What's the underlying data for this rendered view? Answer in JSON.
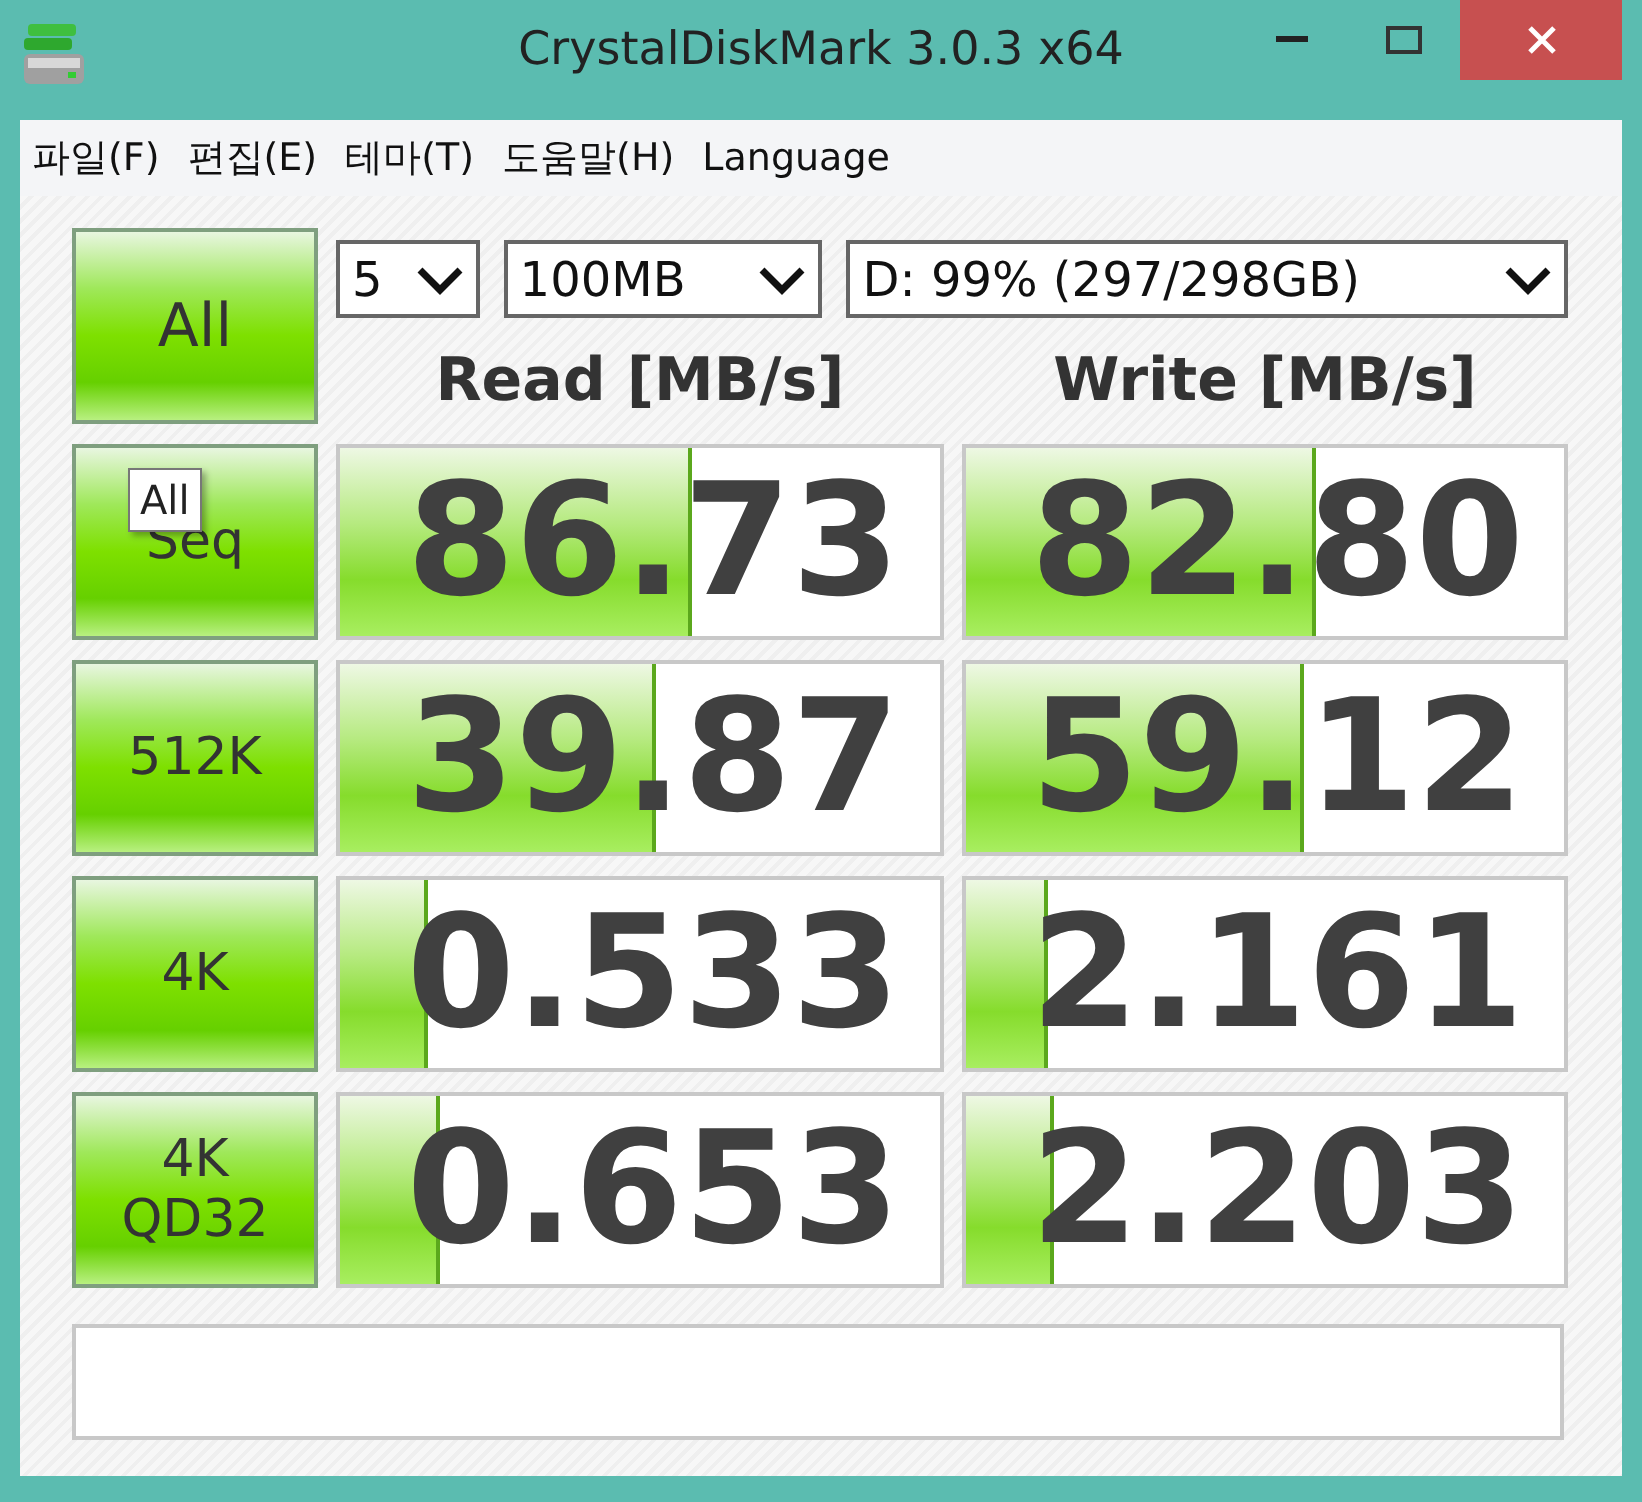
{
  "window": {
    "title": "CrystalDiskMark 3.0.3 x64"
  },
  "menu": [
    "파일(F)",
    "편집(E)",
    "테마(T)",
    "도움말(H)",
    "Language"
  ],
  "all_button": {
    "label": "All"
  },
  "selectors": [
    {
      "value": "5"
    },
    {
      "value": "100MB"
    },
    {
      "value": "D: 99% (297/298GB)"
    }
  ],
  "headers": [
    "Read [MB/s]",
    "Write [MB/s]"
  ],
  "rows": [
    {
      "label": [
        "Seq"
      ],
      "read": {
        "value": "86.73",
        "level": 0.58
      },
      "write": {
        "value": "82.80",
        "level": 0.58
      }
    },
    {
      "label": [
        "512K"
      ],
      "read": {
        "value": "39.87",
        "level": 0.52
      },
      "write": {
        "value": "59.12",
        "level": 0.56
      }
    },
    {
      "label": [
        "4K"
      ],
      "read": {
        "value": "0.533",
        "level": 0.14
      },
      "write": {
        "value": "2.161",
        "level": 0.13
      }
    },
    {
      "label": [
        "4K",
        "QD32"
      ],
      "read": {
        "value": "0.653",
        "level": 0.16
      },
      "write": {
        "value": "2.203",
        "level": 0.14
      }
    }
  ],
  "tooltip": "All"
}
